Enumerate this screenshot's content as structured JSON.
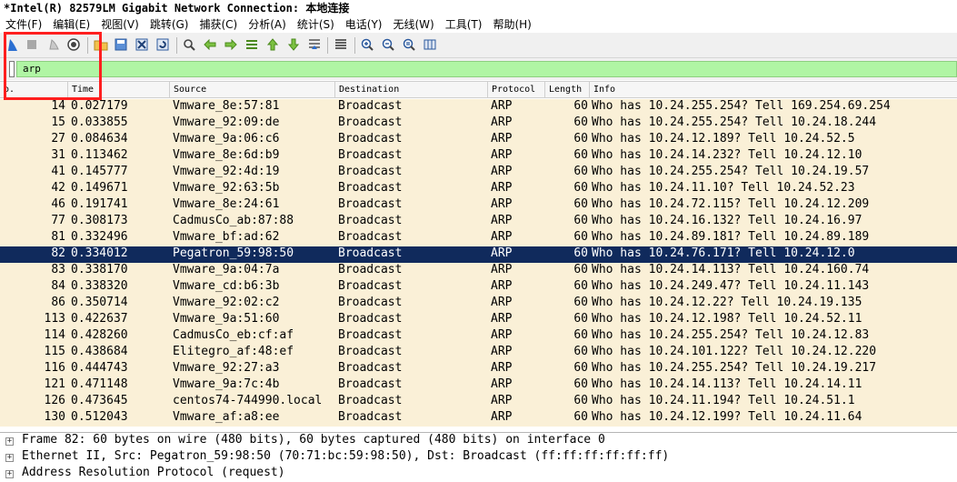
{
  "window": {
    "title": "*Intel(R) 82579LM Gigabit Network Connection: 本地连接"
  },
  "menu": [
    "文件(F)",
    "编辑(E)",
    "视图(V)",
    "跳转(G)",
    "捕获(C)",
    "分析(A)",
    "统计(S)",
    "电话(Y)",
    "无线(W)",
    "工具(T)",
    "帮助(H)"
  ],
  "toolbar": {
    "icons": [
      "shark-fin-start-icon",
      "stop-icon",
      "restart-icon",
      "capture-options-icon",
      "open-folder-icon",
      "save-file-icon",
      "close-file-icon",
      "reload-icon",
      "find-icon",
      "back-arrow-icon",
      "forward-arrow-icon",
      "go-to-packet-icon",
      "first-packet-icon",
      "last-packet-icon",
      "autoscroll-icon",
      "colorize-icon",
      "zoom-in-icon",
      "zoom-out-icon",
      "normal-size-icon",
      "resize-columns-icon"
    ]
  },
  "filter": {
    "value": "arp"
  },
  "columns": [
    "o.",
    "Time",
    "Source",
    "Destination",
    "Protocol",
    "Length",
    "Info"
  ],
  "packets": [
    {
      "no": "14",
      "time": "0.027179",
      "src": "Vmware_8e:57:81",
      "dst": "Broadcast",
      "proto": "ARP",
      "len": "60",
      "info": "Who has 10.24.255.254? Tell 169.254.69.254"
    },
    {
      "no": "15",
      "time": "0.033855",
      "src": "Vmware_92:09:de",
      "dst": "Broadcast",
      "proto": "ARP",
      "len": "60",
      "info": "Who has 10.24.255.254? Tell 10.24.18.244"
    },
    {
      "no": "27",
      "time": "0.084634",
      "src": "Vmware_9a:06:c6",
      "dst": "Broadcast",
      "proto": "ARP",
      "len": "60",
      "info": "Who has 10.24.12.189? Tell 10.24.52.5"
    },
    {
      "no": "31",
      "time": "0.113462",
      "src": "Vmware_8e:6d:b9",
      "dst": "Broadcast",
      "proto": "ARP",
      "len": "60",
      "info": "Who has 10.24.14.232? Tell 10.24.12.10"
    },
    {
      "no": "41",
      "time": "0.145777",
      "src": "Vmware_92:4d:19",
      "dst": "Broadcast",
      "proto": "ARP",
      "len": "60",
      "info": "Who has 10.24.255.254? Tell 10.24.19.57"
    },
    {
      "no": "42",
      "time": "0.149671",
      "src": "Vmware_92:63:5b",
      "dst": "Broadcast",
      "proto": "ARP",
      "len": "60",
      "info": "Who has 10.24.11.10? Tell 10.24.52.23"
    },
    {
      "no": "46",
      "time": "0.191741",
      "src": "Vmware_8e:24:61",
      "dst": "Broadcast",
      "proto": "ARP",
      "len": "60",
      "info": "Who has 10.24.72.115? Tell 10.24.12.209"
    },
    {
      "no": "77",
      "time": "0.308173",
      "src": "CadmusCo_ab:87:88",
      "dst": "Broadcast",
      "proto": "ARP",
      "len": "60",
      "info": "Who has 10.24.16.132? Tell 10.24.16.97"
    },
    {
      "no": "81",
      "time": "0.332496",
      "src": "Vmware_bf:ad:62",
      "dst": "Broadcast",
      "proto": "ARP",
      "len": "60",
      "info": "Who has 10.24.89.181? Tell 10.24.89.189"
    },
    {
      "no": "82",
      "time": "0.334012",
      "src": "Pegatron_59:98:50",
      "dst": "Broadcast",
      "proto": "ARP",
      "len": "60",
      "info": "Who has 10.24.76.171? Tell 10.24.12.0",
      "selected": true
    },
    {
      "no": "83",
      "time": "0.338170",
      "src": "Vmware_9a:04:7a",
      "dst": "Broadcast",
      "proto": "ARP",
      "len": "60",
      "info": "Who has 10.24.14.113? Tell 10.24.160.74"
    },
    {
      "no": "84",
      "time": "0.338320",
      "src": "Vmware_cd:b6:3b",
      "dst": "Broadcast",
      "proto": "ARP",
      "len": "60",
      "info": "Who has 10.24.249.47? Tell 10.24.11.143"
    },
    {
      "no": "86",
      "time": "0.350714",
      "src": "Vmware_92:02:c2",
      "dst": "Broadcast",
      "proto": "ARP",
      "len": "60",
      "info": "Who has 10.24.12.22? Tell 10.24.19.135"
    },
    {
      "no": "113",
      "time": "0.422637",
      "src": "Vmware_9a:51:60",
      "dst": "Broadcast",
      "proto": "ARP",
      "len": "60",
      "info": "Who has 10.24.12.198? Tell 10.24.52.11"
    },
    {
      "no": "114",
      "time": "0.428260",
      "src": "CadmusCo_eb:cf:af",
      "dst": "Broadcast",
      "proto": "ARP",
      "len": "60",
      "info": "Who has 10.24.255.254? Tell 10.24.12.83"
    },
    {
      "no": "115",
      "time": "0.438684",
      "src": "Elitegro_af:48:ef",
      "dst": "Broadcast",
      "proto": "ARP",
      "len": "60",
      "info": "Who has 10.24.101.122? Tell 10.24.12.220"
    },
    {
      "no": "116",
      "time": "0.444743",
      "src": "Vmware_92:27:a3",
      "dst": "Broadcast",
      "proto": "ARP",
      "len": "60",
      "info": "Who has 10.24.255.254? Tell 10.24.19.217"
    },
    {
      "no": "121",
      "time": "0.471148",
      "src": "Vmware_9a:7c:4b",
      "dst": "Broadcast",
      "proto": "ARP",
      "len": "60",
      "info": "Who has 10.24.14.113? Tell 10.24.14.11"
    },
    {
      "no": "126",
      "time": "0.473645",
      "src": "centos74-744990.local",
      "dst": "Broadcast",
      "proto": "ARP",
      "len": "60",
      "info": "Who has 10.24.11.194? Tell 10.24.51.1"
    },
    {
      "no": "130",
      "time": "0.512043",
      "src": "Vmware_af:a8:ee",
      "dst": "Broadcast",
      "proto": "ARP",
      "len": "60",
      "info": "Who has 10.24.12.199? Tell 10.24.11.64"
    }
  ],
  "details": [
    "Frame 82: 60 bytes on wire (480 bits), 60 bytes captured (480 bits) on interface 0",
    "Ethernet II, Src: Pegatron_59:98:50 (70:71:bc:59:98:50), Dst: Broadcast (ff:ff:ff:ff:ff:ff)",
    "Address Resolution Protocol (request)"
  ],
  "colors": {
    "row_bg": "#faf0d7",
    "selected_bg": "#102a5c",
    "filter_bg": "#b0f5a4",
    "highlight": "#ff1f1f"
  }
}
